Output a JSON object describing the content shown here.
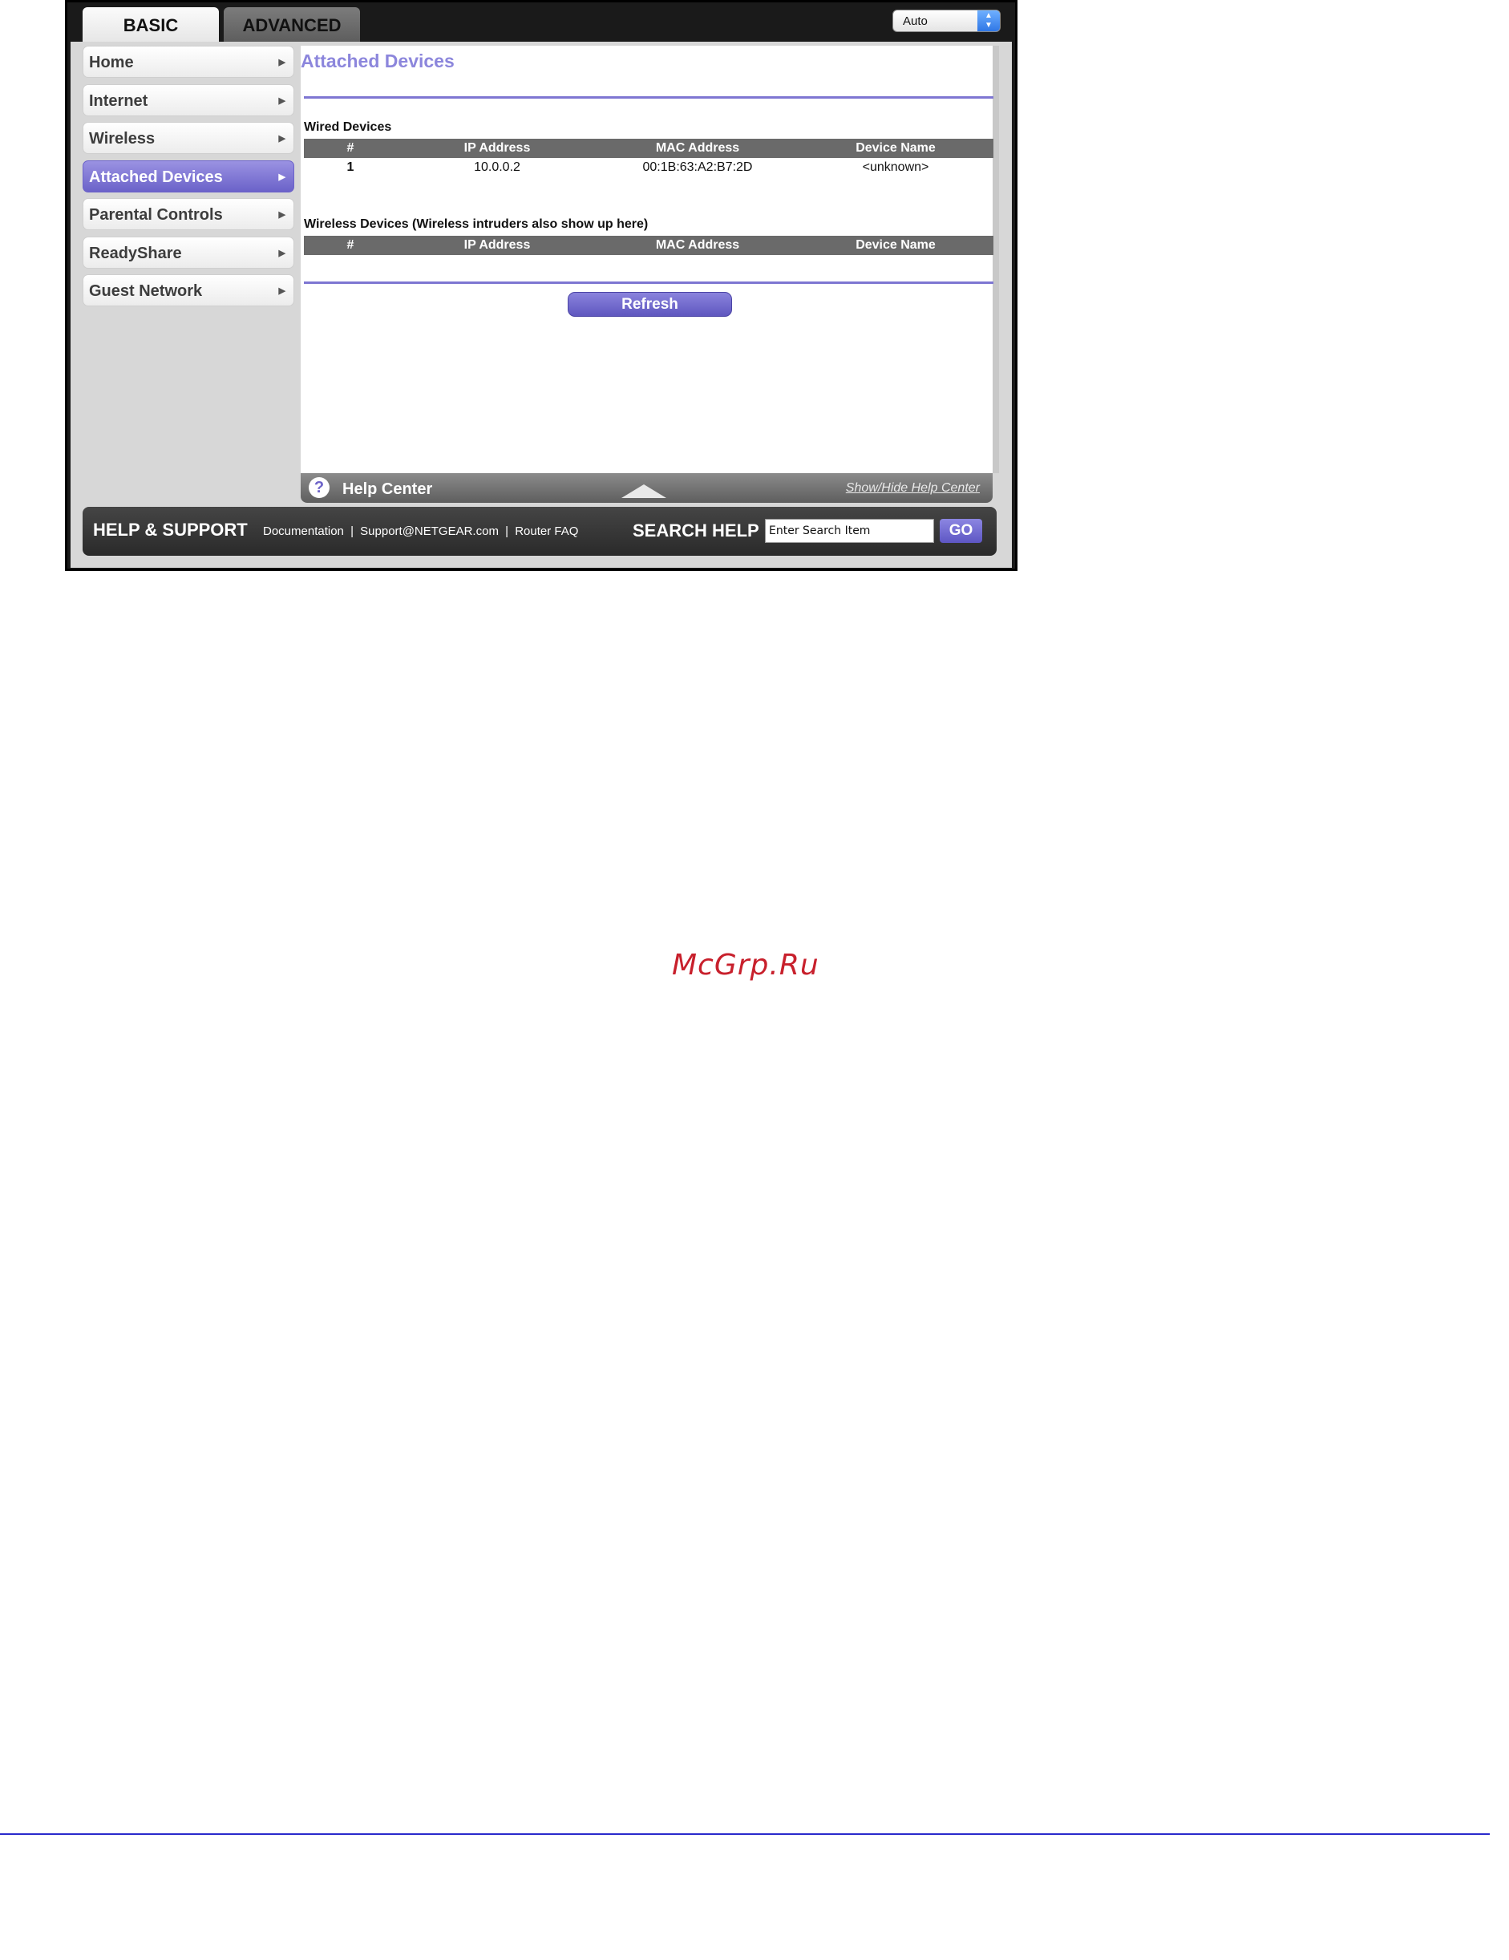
{
  "tabs": {
    "basic": "BASIC",
    "advanced": "ADVANCED"
  },
  "language_select": {
    "value": "Auto"
  },
  "sidebar": {
    "items": [
      {
        "label": "Home"
      },
      {
        "label": "Internet"
      },
      {
        "label": "Wireless"
      },
      {
        "label": "Attached Devices",
        "active": true
      },
      {
        "label": "Parental Controls"
      },
      {
        "label": "ReadyShare"
      },
      {
        "label": "Guest Network"
      }
    ]
  },
  "main": {
    "title": "Attached Devices",
    "wired": {
      "label": "Wired Devices",
      "columns": [
        "#",
        "IP Address",
        "MAC Address",
        "Device Name"
      ],
      "rows": [
        [
          "1",
          "10.0.0.2",
          "00:1B:63:A2:B7:2D",
          "<unknown>"
        ]
      ]
    },
    "wireless": {
      "label": "Wireless Devices (Wireless intruders also show up here)",
      "columns": [
        "#",
        "IP Address",
        "MAC Address",
        "Device Name"
      ],
      "rows": []
    },
    "refresh_label": "Refresh"
  },
  "help_center": {
    "label": "Help Center",
    "icon": "?",
    "toggle_link": "Show/Hide Help Center"
  },
  "support": {
    "title": "HELP & SUPPORT",
    "links": [
      "Documentation",
      "Support@NETGEAR.com",
      "Router FAQ"
    ],
    "separator": "|",
    "search_label": "SEARCH HELP",
    "search_value": "Enter Search Item",
    "go_label": "GO"
  },
  "watermark": "McGrp.Ru",
  "colors": {
    "accent": "#7e76d2",
    "title": "#8c86dc",
    "watermark": "#c8202c",
    "footer_rule": "#2a2acc"
  }
}
